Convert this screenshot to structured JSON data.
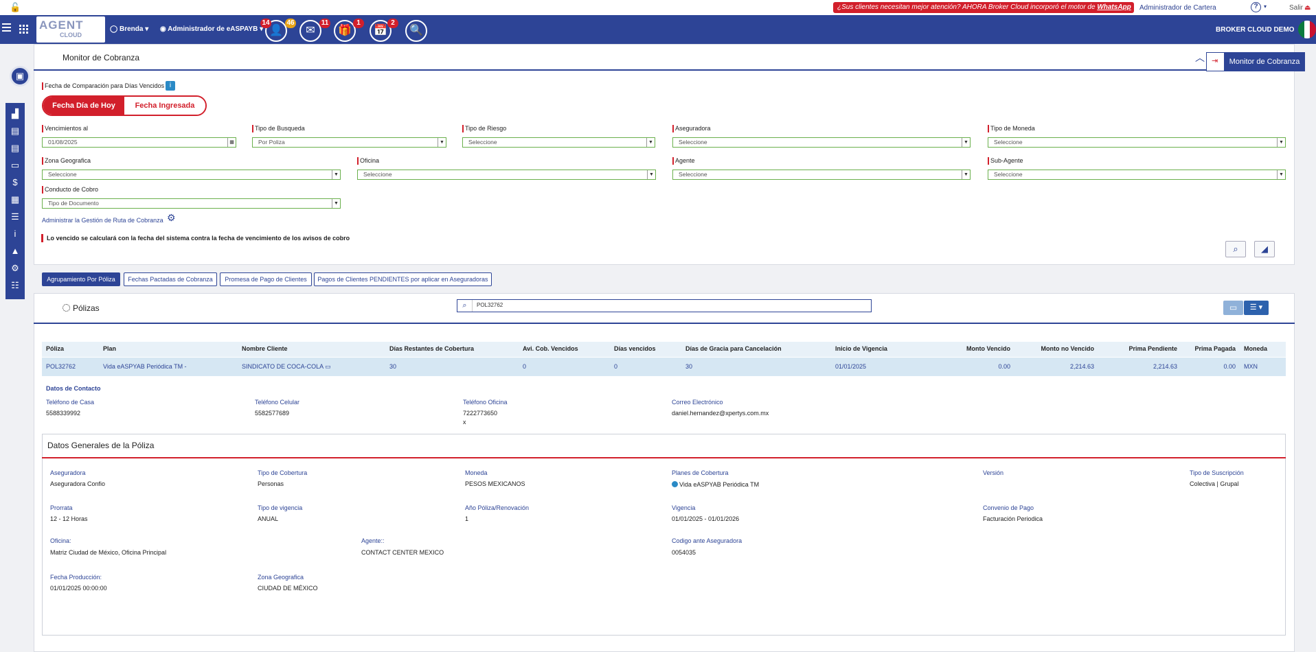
{
  "topbar": {
    "banner_text": "¿Sus clientes necesitan mejor atención? AHORA Broker Cloud incorporó el motor de",
    "banner_link": "WhatsApp",
    "banner_close": "×",
    "admin_cartera": "Administrador de Cartera",
    "help": "?",
    "salir": "Salir"
  },
  "header": {
    "logo_text": "AGENT",
    "logo_sub": "CLOUD",
    "user": "Brenda",
    "role": "Administrador de eASPAYB",
    "badges": {
      "contacts": "14",
      "contacts2": "46",
      "mail": "11",
      "gift": "1",
      "calendar": "2"
    },
    "company": "BROKER CLOUD DEMO"
  },
  "monitor": {
    "page_title": "Monitor de Cobranza",
    "button_label": "Monitor de Cobranza",
    "fecha_label": "Fecha de Comparación para Días Vencidos",
    "toggle_today": "Fecha Día de Hoy",
    "toggle_custom": "Fecha Ingresada",
    "filters": {
      "vencimientos": {
        "label": "Vencimientos al",
        "value": "01/08/2025"
      },
      "tipo_busqueda": {
        "label": "Tipo de Busqueda",
        "value": "Por Poliza"
      },
      "tipo_riesgo": {
        "label": "Tipo de Riesgo",
        "value": "Seleccione"
      },
      "aseguradora": {
        "label": "Aseguradora",
        "value": "Seleccione"
      },
      "tipo_moneda": {
        "label": "Tipo de Moneda",
        "value": "Seleccione"
      },
      "zona": {
        "label": "Zona Geografica",
        "value": "Seleccione"
      },
      "oficina": {
        "label": "Oficina",
        "value": "Seleccione"
      },
      "agente": {
        "label": "Agente",
        "value": "Seleccione"
      },
      "subagente": {
        "label": "Sub-Agente",
        "value": "Seleccione"
      },
      "conducto": {
        "label": "Conducto de Cobro",
        "value": "Tipo de Documento"
      }
    },
    "admin_link": "Administrar la Gestión de Ruta de Cobranza",
    "warning": "Lo vencido se calculará con la fecha del sistema contra la fecha de vencimiento de los avisos de cobro"
  },
  "tabs": [
    "Agrupamiento Por Póliza",
    "Fechas Pactadas de Cobranza",
    "Promesa de Pago de Clientes",
    "Pagos de Clientes PENDIENTES por aplicar en Aseguradoras"
  ],
  "results": {
    "title": "Pólizas",
    "search_value": "POL32762",
    "columns": [
      "Póliza",
      "Plan",
      "Nombre Cliente",
      "Días Restantes de Cobertura",
      "Avi. Cob. Vencidos",
      "Días vencidos",
      "Días de Gracia para Cancelación",
      "Inicio de Vigencia",
      "Monto Vencido",
      "Monto no Vencido",
      "Prima Pendiente",
      "Prima Pagada",
      "Moneda"
    ],
    "row": [
      "POL32762",
      "Vida eASPYAB Periódica TM -",
      "SINDICATO DE COCA-COLA",
      "30",
      "0",
      "0",
      "30",
      "01/01/2025",
      "0.00",
      "2,214.63",
      "2,214.63",
      "0.00",
      "MXN"
    ],
    "contact": {
      "title": "Datos de Contacto",
      "casa_label": "Teléfono de Casa",
      "casa": "5588339992",
      "celular_label": "Teléfono Celular",
      "celular": "5582577689",
      "oficina_label": "Teléfono Oficina",
      "oficina": "7222773650",
      "oficina_ext": "x",
      "correo_label": "Correo Electrónico",
      "correo": "daniel.hernandez@xpertys.com.mx"
    },
    "general": {
      "title": "Datos Generales de la Póliza",
      "aseguradora_l": "Aseguradora",
      "aseguradora": "Aseguradora Confio",
      "cobertura_l": "Tipo de Cobertura",
      "cobertura": "Personas",
      "moneda_l": "Moneda",
      "moneda": "PESOS MEXICANOS",
      "planes_l": "Planes de Cobertura",
      "planes": "Vida eASPYAB Periódica TM",
      "version_l": "Versión",
      "suscripcion_l": "Tipo de Suscripción",
      "suscripcion": "Colectiva | Grupal",
      "prorrata_l": "Prorrata",
      "prorrata": "12 - 12 Horas",
      "vigencia_tipo_l": "Tipo de vigencia",
      "vigencia_tipo": "ANUAL",
      "anio_l": "Año Póliza/Renovación",
      "anio": "1",
      "vigencia_l": "Vigencia",
      "vigencia": "01/01/2025 - 01/01/2026",
      "convenio_l": "Convenio de Pago",
      "convenio": "Facturación Periodica",
      "oficina_l": "Oficina:",
      "oficina": "Matriz Ciudad de México, Oficina Principal",
      "agente_l": "Agente::",
      "agente": "CONTACT CENTER MEXICO",
      "codigo_l": "Codigo ante Aseguradora",
      "codigo": "0054035",
      "produccion_l": "Fecha Producción:",
      "produccion": "01/01/2025 00:00:00",
      "zona_l": "Zona Geografica",
      "zona": "CIUDAD DE MÉXICO"
    }
  }
}
